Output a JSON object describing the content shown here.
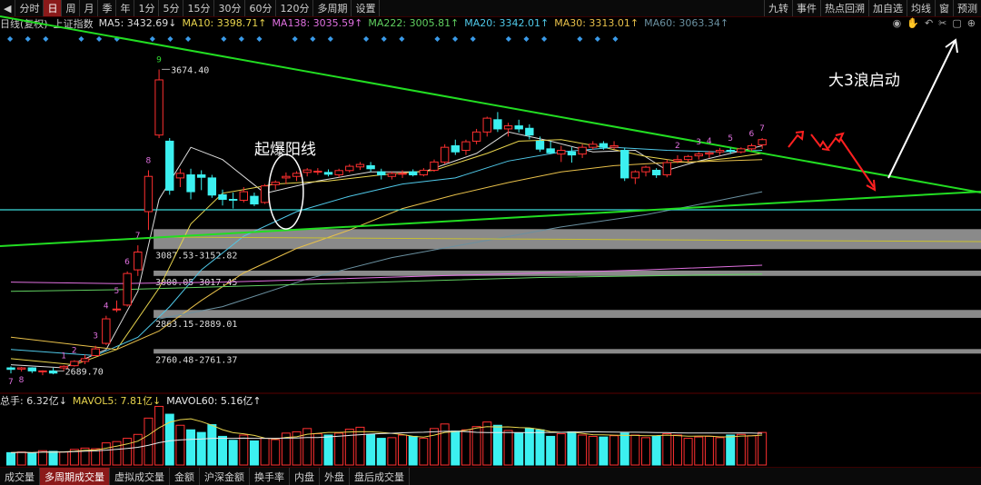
{
  "toolbar": {
    "nav_icon": "◀",
    "periods": [
      "分时",
      "日",
      "周",
      "月",
      "季",
      "年",
      "1分",
      "5分",
      "15分",
      "30分",
      "60分",
      "120分",
      "多周期",
      "设置"
    ],
    "active_period": 1,
    "right_items": [
      "九转",
      "事件",
      "热点回溯",
      "加自选",
      "均线",
      "窗",
      "预测"
    ]
  },
  "ma_bar": {
    "period_name": "日线(复权)",
    "index_name": "上证指数",
    "items": [
      {
        "label": "MA5: 3432.69↓",
        "color": "#dddddd"
      },
      {
        "label": "MA10: 3398.71↑",
        "color": "#e8d44d"
      },
      {
        "label": "MA138: 3035.59↑",
        "color": "#e070e0"
      },
      {
        "label": "MA222: 3005.81↑",
        "color": "#60d060"
      },
      {
        "label": "MA20: 3342.01↑",
        "color": "#4fc8e8"
      },
      {
        "label": "MA30: 3313.01↑",
        "color": "#e8c04a"
      },
      {
        "label": "MA60: 3063.34↑",
        "color": "#6a90a0"
      }
    ]
  },
  "tool_icons": [
    "eye-icon",
    "hand-icon",
    "undo-icon",
    "scissors-icon",
    "lock-icon",
    "add-icon"
  ],
  "vol_bar": {
    "items": [
      {
        "label": "总手: 6.32亿↓",
        "color": "#dddddd"
      },
      {
        "label": "MAVOL5: 7.81亿↓",
        "color": "#e8d44d"
      },
      {
        "label": "MAVOL60: 5.16亿↑",
        "color": "#e8e8e8"
      }
    ]
  },
  "bottom_tabs": [
    "成交量",
    "多周期成交量",
    "虚拟成交量",
    "金额",
    "沪深金额",
    "换手率",
    "内盘",
    "外盘",
    "盘后成交量"
  ],
  "active_bottom_tab": 1,
  "annotations": {
    "breakout": "起爆阳线",
    "wave3": "大3浪启动"
  },
  "colors": {
    "up": "#ff3030",
    "down": "#3cf0f0",
    "trend": "#22dd22",
    "zone": "#888888"
  },
  "chart_data": {
    "type": "candlestick",
    "ylim": [
      2620,
      3800
    ],
    "candles": [
      [
        2700,
        2705,
        2682,
        2695
      ],
      [
        2696,
        2703,
        2688,
        2700
      ],
      [
        2700,
        2702,
        2683,
        2690
      ],
      [
        2687,
        2692,
        2676,
        2690
      ],
      [
        2690,
        2700,
        2679,
        2683
      ],
      [
        2700,
        2708,
        2690,
        2705
      ],
      [
        2707,
        2725,
        2704,
        2721
      ],
      [
        2721,
        2743,
        2712,
        2730
      ],
      [
        2740,
        2772,
        2738,
        2762
      ],
      [
        2780,
        2870,
        2775,
        2860
      ],
      [
        2890,
        2920,
        2882,
        2892
      ],
      [
        2905,
        3015,
        2900,
        3008
      ],
      [
        3020,
        3100,
        3000,
        3078
      ],
      [
        3210,
        3345,
        3150,
        3325
      ],
      [
        3460,
        3674,
        3450,
        3640
      ],
      [
        3440,
        3450,
        3265,
        3280
      ],
      [
        3320,
        3350,
        3290,
        3335
      ],
      [
        3330,
        3350,
        3250,
        3275
      ],
      [
        3330,
        3345,
        3280,
        3322
      ],
      [
        3320,
        3330,
        3255,
        3264
      ],
      [
        3265,
        3282,
        3230,
        3250
      ],
      [
        3250,
        3272,
        3220,
        3248
      ],
      [
        3247,
        3290,
        3240,
        3275
      ],
      [
        3260,
        3272,
        3228,
        3235
      ],
      [
        3240,
        3300,
        3235,
        3294
      ],
      [
        3298,
        3312,
        3282,
        3306
      ],
      [
        3320,
        3338,
        3300,
        3325
      ],
      [
        3325,
        3342,
        3310,
        3335
      ],
      [
        3338,
        3352,
        3325,
        3346
      ],
      [
        3342,
        3352,
        3330,
        3342
      ],
      [
        3338,
        3348,
        3325,
        3332
      ],
      [
        3330,
        3350,
        3322,
        3344
      ],
      [
        3344,
        3365,
        3338,
        3358
      ],
      [
        3356,
        3372,
        3346,
        3364
      ],
      [
        3360,
        3372,
        3340,
        3350
      ],
      [
        3340,
        3350,
        3315,
        3330
      ],
      [
        3325,
        3340,
        3315,
        3334
      ],
      [
        3332,
        3345,
        3320,
        3335
      ],
      [
        3340,
        3348,
        3325,
        3330
      ],
      [
        3330,
        3352,
        3325,
        3345
      ],
      [
        3345,
        3380,
        3340,
        3372
      ],
      [
        3372,
        3430,
        3365,
        3420
      ],
      [
        3425,
        3445,
        3395,
        3405
      ],
      [
        3410,
        3445,
        3395,
        3438
      ],
      [
        3440,
        3480,
        3430,
        3470
      ],
      [
        3470,
        3520,
        3455,
        3515
      ],
      [
        3510,
        3535,
        3470,
        3480
      ],
      [
        3480,
        3500,
        3455,
        3490
      ],
      [
        3490,
        3510,
        3468,
        3480
      ],
      [
        3482,
        3495,
        3446,
        3460
      ],
      [
        3440,
        3455,
        3405,
        3414
      ],
      [
        3415,
        3440,
        3398,
        3402
      ],
      [
        3398,
        3425,
        3372,
        3410
      ],
      [
        3405,
        3420,
        3370,
        3395
      ],
      [
        3398,
        3430,
        3385,
        3420
      ],
      [
        3420,
        3440,
        3412,
        3430
      ],
      [
        3432,
        3440,
        3412,
        3420
      ],
      [
        3420,
        3440,
        3414,
        3425
      ],
      [
        3410,
        3418,
        3310,
        3320
      ],
      [
        3320,
        3345,
        3300,
        3340
      ],
      [
        3340,
        3360,
        3325,
        3355
      ],
      [
        3345,
        3352,
        3320,
        3330
      ],
      [
        3330,
        3380,
        3322,
        3370
      ],
      [
        3375,
        3394,
        3368,
        3380
      ],
      [
        3380,
        3395,
        3372,
        3390
      ],
      [
        3392,
        3405,
        3380,
        3398
      ],
      [
        3398,
        3408,
        3385,
        3402
      ],
      [
        3405,
        3418,
        3395,
        3410
      ],
      [
        3410,
        3418,
        3398,
        3408
      ],
      [
        3405,
        3420,
        3400,
        3415
      ],
      [
        3415,
        3432,
        3408,
        3425
      ],
      [
        3428,
        3450,
        3415,
        3445
      ]
    ],
    "volume": [
      1.9,
      2.0,
      1.8,
      2.2,
      2.1,
      2.0,
      2.4,
      2.6,
      2.5,
      3.4,
      3.6,
      4.1,
      4.7,
      7.2,
      9.0,
      7.8,
      6.1,
      5.4,
      5.0,
      6.2,
      4.4,
      3.8,
      4.6,
      3.7,
      4.1,
      3.9,
      4.9,
      5.1,
      5.6,
      4.8,
      4.6,
      4.9,
      5.5,
      5.8,
      4.7,
      4.1,
      4.2,
      4.6,
      4.4,
      4.1,
      5.6,
      6.3,
      5.2,
      5.4,
      5.9,
      6.6,
      6.1,
      5.3,
      4.9,
      5.6,
      5.4,
      4.4,
      4.8,
      5.1,
      4.6,
      4.4,
      4.3,
      4.5,
      4.9,
      4.6,
      4.2,
      4.4,
      4.8,
      4.6,
      4.1,
      4.3,
      4.4,
      4.2,
      4.6,
      4.7,
      4.5,
      5.0
    ],
    "ma_lines": [
      {
        "name": "MA5",
        "color": "#dddddd",
        "points": [
          [
            0,
            2710
          ],
          [
            5,
            2700
          ],
          [
            9,
            2760
          ],
          [
            12,
            2950
          ],
          [
            14,
            3250
          ],
          [
            17,
            3420
          ],
          [
            20,
            3380
          ],
          [
            24,
            3270
          ],
          [
            29,
            3310
          ],
          [
            34,
            3340
          ],
          [
            39,
            3340
          ],
          [
            44,
            3400
          ],
          [
            47,
            3470
          ],
          [
            51,
            3440
          ],
          [
            55,
            3405
          ],
          [
            59,
            3410
          ],
          [
            62,
            3345
          ],
          [
            65,
            3375
          ],
          [
            68,
            3400
          ],
          [
            71,
            3425
          ]
        ]
      },
      {
        "name": "MA10",
        "color": "#e8d44d",
        "points": [
          [
            0,
            2730
          ],
          [
            6,
            2710
          ],
          [
            10,
            2760
          ],
          [
            14,
            2960
          ],
          [
            17,
            3170
          ],
          [
            20,
            3270
          ],
          [
            25,
            3300
          ],
          [
            30,
            3310
          ],
          [
            35,
            3330
          ],
          [
            40,
            3345
          ],
          [
            45,
            3400
          ],
          [
            48,
            3440
          ],
          [
            52,
            3445
          ],
          [
            56,
            3420
          ],
          [
            60,
            3390
          ],
          [
            64,
            3370
          ],
          [
            68,
            3385
          ],
          [
            71,
            3400
          ]
        ]
      },
      {
        "name": "MA20",
        "color": "#4fc8e8",
        "points": [
          [
            0,
            2760
          ],
          [
            8,
            2740
          ],
          [
            12,
            2800
          ],
          [
            15,
            2900
          ],
          [
            18,
            3020
          ],
          [
            22,
            3130
          ],
          [
            27,
            3210
          ],
          [
            32,
            3260
          ],
          [
            37,
            3300
          ],
          [
            42,
            3320
          ],
          [
            47,
            3375
          ],
          [
            52,
            3405
          ],
          [
            57,
            3420
          ],
          [
            62,
            3410
          ],
          [
            67,
            3405
          ],
          [
            71,
            3410
          ]
        ]
      },
      {
        "name": "MA30",
        "color": "#e8c04a",
        "points": [
          [
            0,
            2800
          ],
          [
            10,
            2760
          ],
          [
            14,
            2820
          ],
          [
            18,
            2920
          ],
          [
            22,
            3010
          ],
          [
            27,
            3090
          ],
          [
            32,
            3150
          ],
          [
            37,
            3220
          ],
          [
            42,
            3265
          ],
          [
            47,
            3305
          ],
          [
            52,
            3340
          ],
          [
            57,
            3360
          ],
          [
            62,
            3370
          ],
          [
            67,
            3375
          ],
          [
            71,
            3380
          ]
        ]
      },
      {
        "name": "MA60",
        "color": "#6a90a0",
        "points": [
          [
            14,
            2860
          ],
          [
            20,
            2900
          ],
          [
            28,
            2990
          ],
          [
            36,
            3060
          ],
          [
            44,
            3110
          ],
          [
            52,
            3160
          ],
          [
            60,
            3200
          ],
          [
            66,
            3240
          ],
          [
            71,
            3275
          ]
        ]
      },
      {
        "name": "MA138",
        "color": "#e070e0",
        "points": [
          [
            0,
            2980
          ],
          [
            10,
            2975
          ],
          [
            20,
            2980
          ],
          [
            30,
            2990
          ],
          [
            40,
            3000
          ],
          [
            50,
            3010
          ],
          [
            60,
            3020
          ],
          [
            71,
            3035
          ]
        ]
      },
      {
        "name": "MA222",
        "color": "#60d060",
        "points": [
          [
            0,
            2950
          ],
          [
            10,
            2955
          ],
          [
            20,
            2965
          ],
          [
            30,
            2975
          ],
          [
            40,
            2985
          ],
          [
            50,
            2995
          ],
          [
            60,
            3000
          ],
          [
            71,
            3006
          ]
        ]
      }
    ],
    "price_labels": [
      {
        "i": 14,
        "price": 3674.4,
        "text": "3674.40"
      },
      {
        "i": 4,
        "price": 2689.7,
        "text": "2689.70"
      }
    ],
    "zones": [
      {
        "low": 3087.53,
        "high": 3152.82,
        "text": "3087.53-3152.82"
      },
      {
        "low": 3000.05,
        "high": 3017.45,
        "text": "3000.05-3017.45"
      },
      {
        "low": 2863.15,
        "high": 2889.01,
        "text": "2863.15-2889.01"
      },
      {
        "low": 2760.48,
        "high": 2761.37,
        "text": "2760.48-2761.37"
      }
    ],
    "counts": [
      {
        "i": 1,
        "text": "8",
        "color": "#e070e0"
      },
      {
        "i": 0,
        "text": "7",
        "color": "#e070e0"
      },
      {
        "i": 5,
        "text": "1",
        "color": "#e070e0"
      },
      {
        "i": 6,
        "text": "2",
        "color": "#e070e0"
      },
      {
        "i": 8,
        "text": "3",
        "color": "#e070e0"
      },
      {
        "i": 9,
        "text": "4",
        "color": "#e070e0"
      },
      {
        "i": 10,
        "text": "5",
        "color": "#e070e0"
      },
      {
        "i": 11,
        "text": "6",
        "color": "#e070e0"
      },
      {
        "i": 12,
        "text": "7",
        "color": "#e070e0"
      },
      {
        "i": 13,
        "text": "8",
        "color": "#e070e0"
      },
      {
        "i": 14,
        "text": "9",
        "color": "#33dd33"
      },
      {
        "i": 63,
        "text": "2",
        "color": "#e070e0"
      },
      {
        "i": 65,
        "text": "3",
        "color": "#e070e0"
      },
      {
        "i": 66,
        "text": "4",
        "color": "#e070e0"
      },
      {
        "i": 68,
        "text": "5",
        "color": "#e070e0"
      },
      {
        "i": 70,
        "text": "6",
        "color": "#e070e0"
      },
      {
        "i": 71,
        "text": "7",
        "color": "#e070e0"
      }
    ]
  }
}
